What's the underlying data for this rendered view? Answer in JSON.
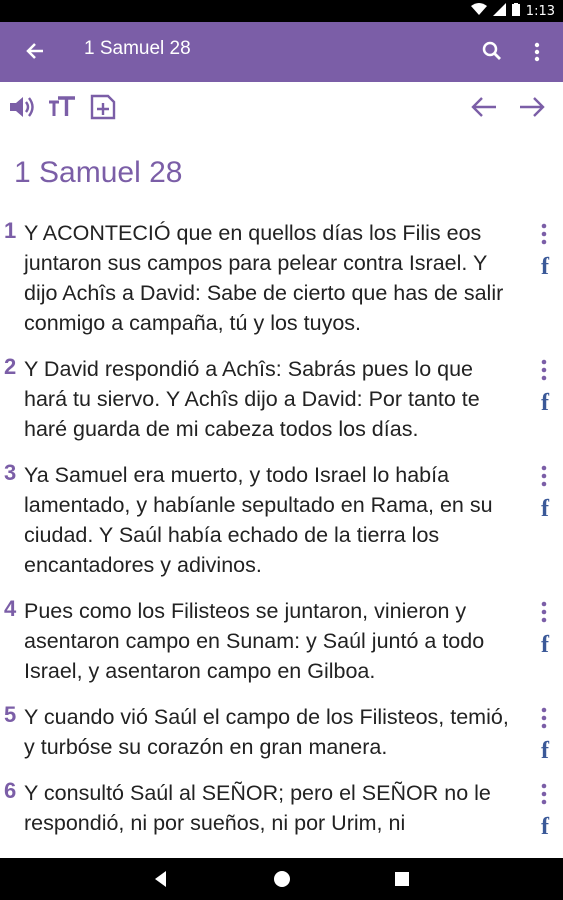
{
  "status": {
    "time": "1:13"
  },
  "appbar": {
    "title": "1 Samuel 28"
  },
  "chapter_title": "1 Samuel 28",
  "verses": [
    {
      "num": "1",
      "text": "Y ACONTECIÓ que en quellos días los Filis eos juntaron sus campos para pelear contra Israel. Y dijo Achîs a David: Sabe de cierto que has de salir conmigo a campaña, tú y los tuyos.",
      "fb": "f"
    },
    {
      "num": "2",
      "text": "Y David respondió a Achîs: Sabrás pues lo que hará tu siervo. Y Achîs dijo a David: Por tanto te haré guarda de mi cabeza todos los días.",
      "fb": "f"
    },
    {
      "num": "3",
      "text": "Ya Samuel era muerto, y todo Israel lo había lamentado, y habíanle sepultado en Rama, en su ciudad. Y Saúl había echado de la tierra los encantadores y adivinos.",
      "fb": "f"
    },
    {
      "num": "4",
      "text": "Pues como los Filisteos se juntaron, vinieron y asentaron campo en Sunam: y Saúl juntó a todo Israel, y asentaron campo en Gilboa.",
      "fb": "f"
    },
    {
      "num": "5",
      "text": "Y cuando vió Saúl el campo de los Filisteos, temió, y turbóse su corazón en gran manera.",
      "fb": "f"
    },
    {
      "num": "6",
      "text": "Y consultó Saúl al SEÑOR; pero el SEÑOR no le respondió, ni por sueños, ni por Urim, ni",
      "fb": "f"
    }
  ],
  "colors": {
    "accent": "#7b5ea7",
    "facebook": "#3b5998"
  }
}
